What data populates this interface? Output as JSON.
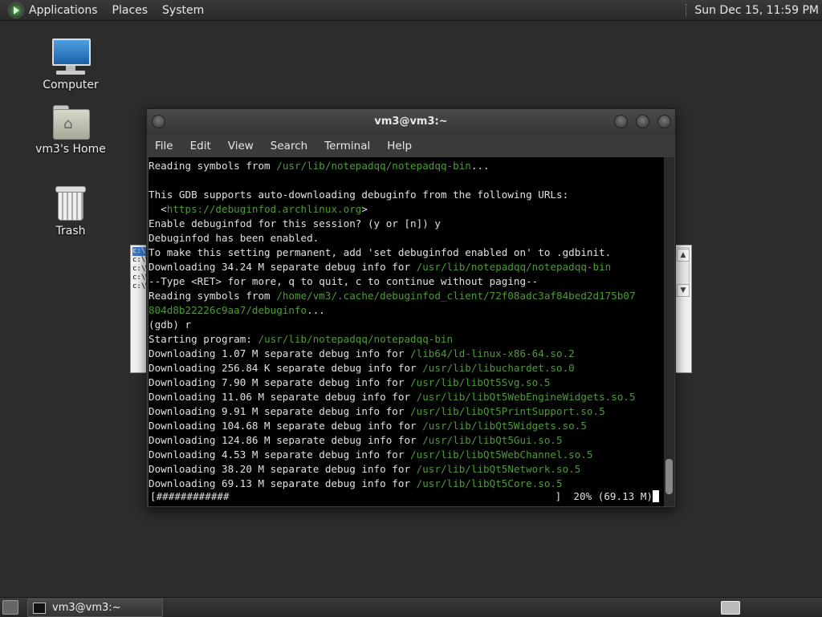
{
  "top_panel": {
    "menus": [
      "Applications",
      "Places",
      "System"
    ],
    "clock": "Sun Dec 15, 11:59 PM"
  },
  "desktop_icons": [
    {
      "label": "Computer",
      "icon": "computer-icon"
    },
    {
      "label": "vm3's Home",
      "icon": "home-folder-icon"
    },
    {
      "label": "Trash",
      "icon": "trash-icon"
    }
  ],
  "background_window": {
    "list_items": [
      "c:\\",
      "c:\\W",
      "c:\\W",
      "c:\\W",
      "c:\\W"
    ]
  },
  "terminal": {
    "title": "vm3@vm3:~",
    "menu": [
      "File",
      "Edit",
      "View",
      "Search",
      "Terminal",
      "Help"
    ],
    "lines": [
      [
        {
          "t": "Reading symbols from "
        },
        {
          "t": "/usr/lib/notepadqq/notepadqq-bin",
          "p": true
        },
        {
          "t": "..."
        }
      ],
      [
        {
          "t": ""
        }
      ],
      [
        {
          "t": "This GDB supports auto-downloading debuginfo from the following URLs:"
        }
      ],
      [
        {
          "t": "  <"
        },
        {
          "t": "https://debuginfod.archlinux.org",
          "p": true
        },
        {
          "t": ">"
        }
      ],
      [
        {
          "t": "Enable debuginfod for this session? (y or [n]) y"
        }
      ],
      [
        {
          "t": "Debuginfod has been enabled."
        }
      ],
      [
        {
          "t": "To make this setting permanent, add 'set debuginfod enabled on' to .gdbinit."
        }
      ],
      [
        {
          "t": "Downloading 34.24 M separate debug info for "
        },
        {
          "t": "/usr/lib/notepadqq/notepadqq-bin",
          "p": true
        }
      ],
      [
        {
          "t": "--Type <RET> for more, q to quit, c to continue without paging--"
        }
      ],
      [
        {
          "t": "Reading symbols from "
        },
        {
          "t": "/home/vm3/.cache/debuginfod_client/72f08adc3af84bed2d175b07",
          "p": true
        }
      ],
      [
        {
          "t": "804d8b22226c9aa7/debuginfo",
          "p": true
        },
        {
          "t": "..."
        }
      ],
      [
        {
          "t": "(gdb) r"
        }
      ],
      [
        {
          "t": "Starting program: "
        },
        {
          "t": "/usr/lib/notepadqq/notepadqq-bin",
          "p": true
        }
      ],
      [
        {
          "t": "Downloading 1.07 M separate debug info for "
        },
        {
          "t": "/lib64/ld-linux-x86-64.so.2",
          "p": true
        }
      ],
      [
        {
          "t": "Downloading 256.84 K separate debug info for "
        },
        {
          "t": "/usr/lib/libuchardet.so.0",
          "p": true
        }
      ],
      [
        {
          "t": "Downloading 7.90 M separate debug info for "
        },
        {
          "t": "/usr/lib/libQt5Svg.so.5",
          "p": true
        }
      ],
      [
        {
          "t": "Downloading 11.06 M separate debug info for "
        },
        {
          "t": "/usr/lib/libQt5WebEngineWidgets.so.5",
          "p": true
        }
      ],
      [
        {
          "t": "Downloading 9.91 M separate debug info for "
        },
        {
          "t": "/usr/lib/libQt5PrintSupport.so.5",
          "p": true
        }
      ],
      [
        {
          "t": "Downloading 104.68 M separate debug info for "
        },
        {
          "t": "/usr/lib/libQt5Widgets.so.5",
          "p": true
        }
      ],
      [
        {
          "t": "Downloading 124.86 M separate debug info for "
        },
        {
          "t": "/usr/lib/libQt5Gui.so.5",
          "p": true
        }
      ],
      [
        {
          "t": "Downloading 4.53 M separate debug info for "
        },
        {
          "t": "/usr/lib/libQt5WebChannel.so.5",
          "p": true
        }
      ],
      [
        {
          "t": "Downloading 38.20 M separate debug info for "
        },
        {
          "t": "/usr/lib/libQt5Network.so.5",
          "p": true
        }
      ],
      [
        {
          "t": "Downloading 69.13 M separate debug info for "
        },
        {
          "t": "/usr/lib/libQt5Core.so.5",
          "p": true
        }
      ]
    ],
    "progress": {
      "bar": "[############",
      "status": "]  20% (69.13 M)"
    }
  },
  "taskbar": {
    "task_label": "vm3@vm3:~"
  },
  "colors": {
    "path_green": "#4e9a3a",
    "terminal_bg": "#000000",
    "panel_bg": "#2c2c2c"
  }
}
